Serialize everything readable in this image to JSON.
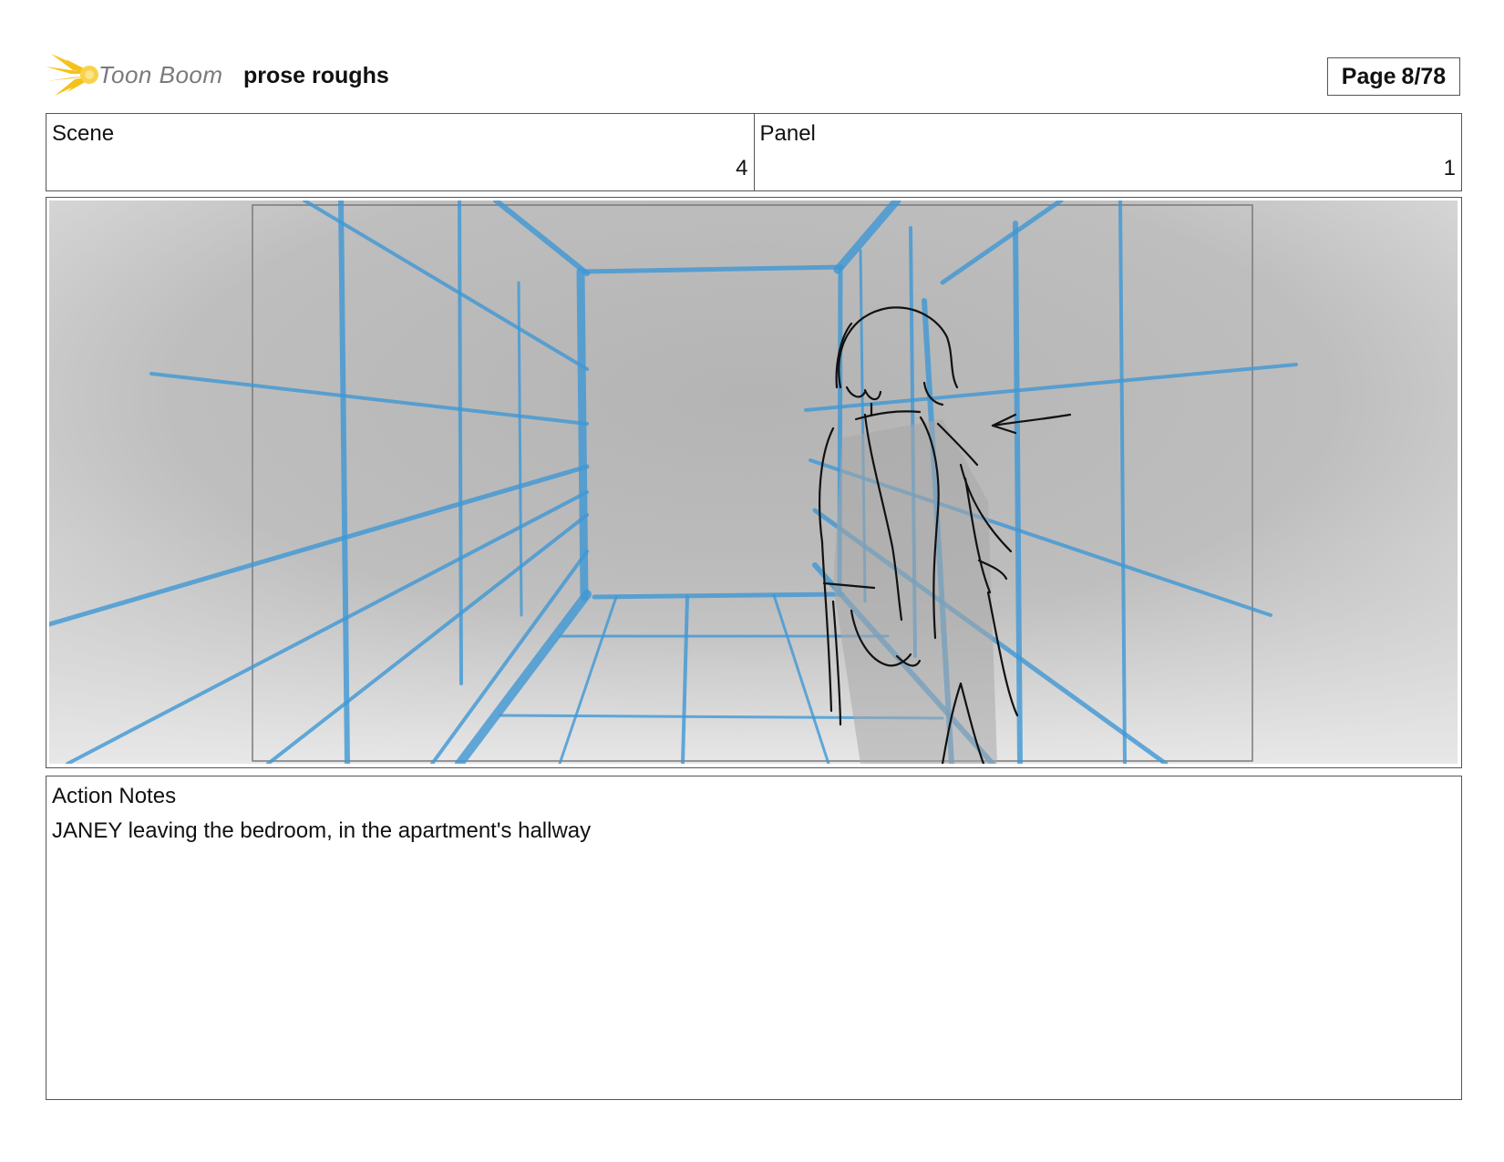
{
  "header": {
    "logo_text": "Toon Boom",
    "project_title": "prose roughs",
    "page_label": "Page",
    "page_value": "8/78"
  },
  "meta": {
    "scene_label": "Scene",
    "scene_value": "4",
    "panel_label": "Panel",
    "panel_value": "1"
  },
  "notes": {
    "label": "Action Notes",
    "text": "JANEY leaving the bedroom, in the apartment's hallway"
  },
  "colors": {
    "guide_blue": "#3f97d4",
    "logo_yellow": "#f5c21a",
    "border": "#555555"
  }
}
